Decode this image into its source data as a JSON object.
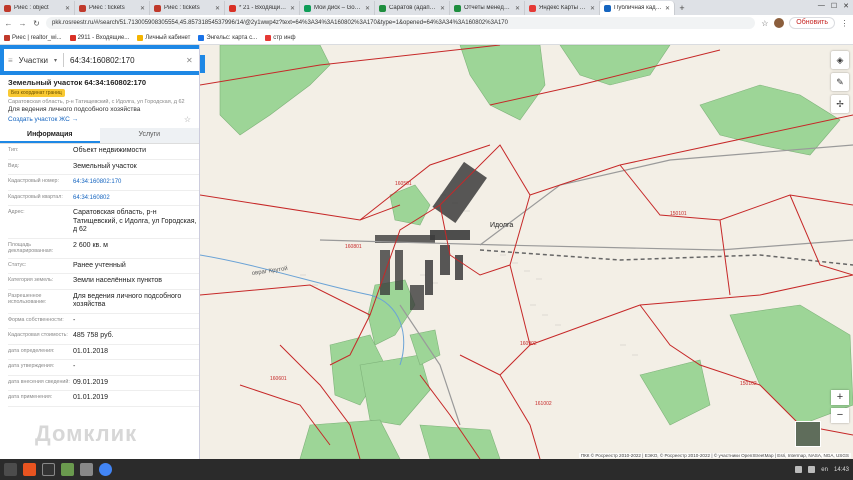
{
  "browser": {
    "tabs": [
      {
        "title": "Риес : object",
        "color": "#c0392b"
      },
      {
        "title": "Риес : tickets",
        "color": "#c0392b"
      },
      {
        "title": "Риес : tickets",
        "color": "#c0392b"
      },
      {
        "title": "* 21 - Входящие —",
        "color": "#d93025"
      },
      {
        "title": "Мой диск – Google",
        "color": "#0f9d58"
      },
      {
        "title": "Саратов (адаптацио",
        "color": "#1e8e3e"
      },
      {
        "title": "Отчеты менеджеро",
        "color": "#1e8e3e"
      },
      {
        "title": "Яндекс Карты — пр",
        "color": "#e53935"
      },
      {
        "title": "Публичная кадастр",
        "color": "#1565c0",
        "active": true
      }
    ],
    "new_tab": "+",
    "url": "pkk.rosreestr.ru/#/search/51.7130059083055​54,45.857318545379​96/14/@2y1wwp4z?text=64%3A34%3A160802%3A170&type=1&opened=64%3A34%3A160802%3A170",
    "update_button": "Обновить",
    "bookmarks": [
      {
        "label": "Риес | realtor_wi...",
        "color": "#c0392b"
      },
      {
        "label": "2911 - Входящие...",
        "color": "#d93025"
      },
      {
        "label": "Личный кабинет",
        "color": "#f4b400"
      },
      {
        "label": "Энгельс: карта с...",
        "color": "#1a73e8"
      },
      {
        "label": "стр инф",
        "color": "#e53935"
      }
    ]
  },
  "search": {
    "mode": "Участки",
    "value": "64:34:160802:170"
  },
  "object": {
    "title": "Земельный участок 64:34:160802:170",
    "badge": "Без координат границ",
    "address": "Саратовская область, р-н Татищевский, с Идолга, ул Городская, д 62",
    "use": "Для ведения личного подсобного хозяйства",
    "create_link": "Создать участок ЖС →"
  },
  "tabs": {
    "info": "Информация",
    "services": "Услуги"
  },
  "rows": [
    {
      "k": "Тип:",
      "v": "Объект недвижимости"
    },
    {
      "k": "Вид:",
      "v": "Земельный участок"
    },
    {
      "k": "Кадастровый номер:",
      "v": "64:34:160802:170",
      "link": true
    },
    {
      "k": "Кадастровый квартал:",
      "v": "64:34:160802",
      "link": true
    },
    {
      "k": "Адрес:",
      "v": "Саратовская область, р-н Татищевский, с Идолга, ул Городская, д 62"
    },
    {
      "k": "Площадь декларированная:",
      "v": "2 600 кв. м"
    },
    {
      "k": "Статус:",
      "v": "Ранее учтенный"
    },
    {
      "k": "Категория земель:",
      "v": "Земли населённых пунктов"
    },
    {
      "k": "Разрешенное использование:",
      "v": "Для ведения личного подсобного хозяйства"
    },
    {
      "k": "Форма собственности:",
      "v": "-"
    },
    {
      "k": "Кадастровая стоимость:",
      "v": "485 758 руб."
    },
    {
      "k": "дата определения:",
      "v": "01.01.2018"
    },
    {
      "k": "дата утверждения:",
      "v": "-"
    },
    {
      "k": "дата внесения сведений:",
      "v": "09.01.2019"
    },
    {
      "k": "дата применения:",
      "v": "01.01.2019"
    }
  ],
  "watermark": "Домклик",
  "map": {
    "village_label": "Идолга",
    "river_label": "овраг Крутой",
    "parcel_labels": [
      "160501",
      "160801",
      "160902",
      "161002",
      "150101",
      "150102",
      "160601"
    ],
    "copyright": "ПКК © Росреестр 2010-2022 | ЕЭКО, © Росреестр 2010-2022 | © участники OpenStreetMap | Esri, Intermap, NASA, NGA, USGS"
  },
  "taskbar": {
    "time": "14:43",
    "lang": "en"
  }
}
